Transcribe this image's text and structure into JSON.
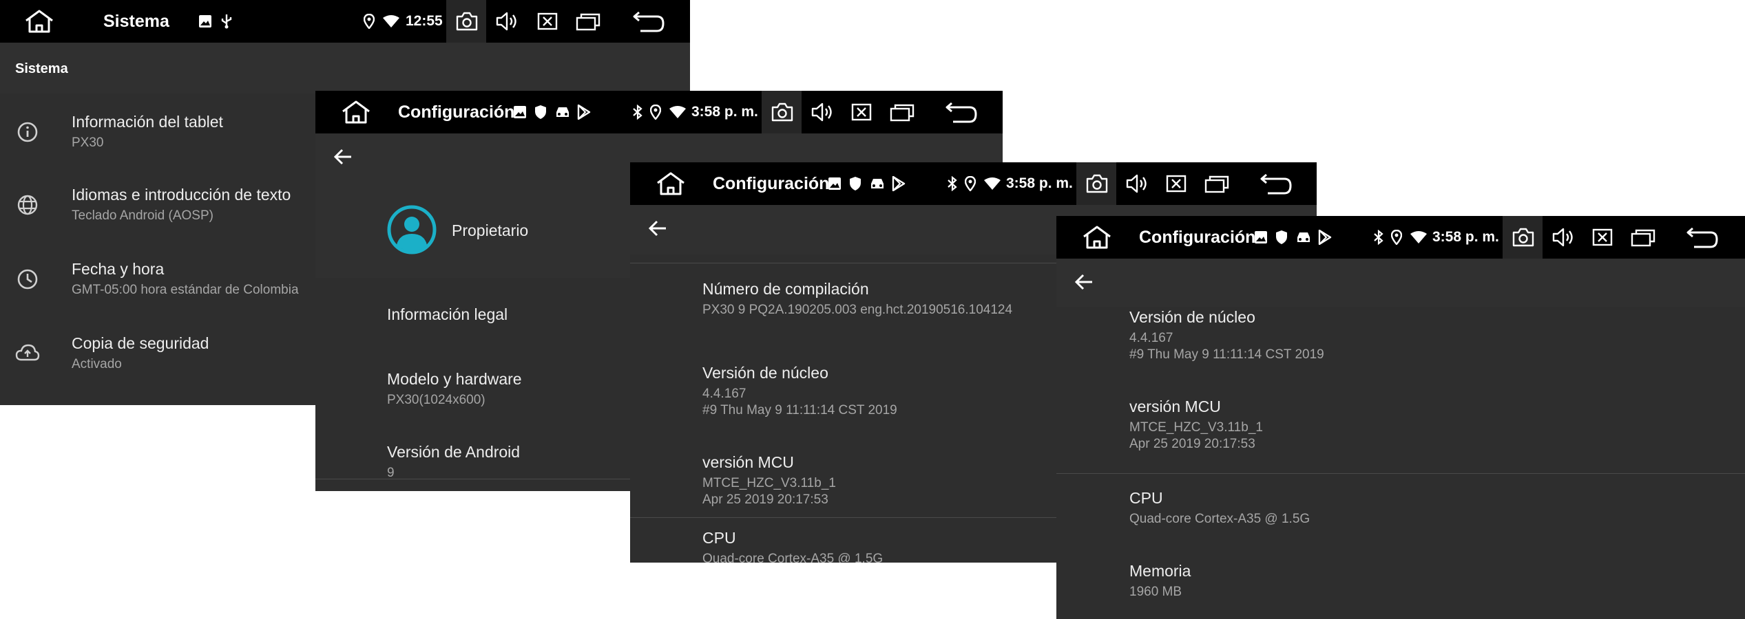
{
  "window1": {
    "status_title": "Sistema",
    "time": "12:55",
    "header": "Sistema",
    "items": [
      {
        "title": "Información del tablet",
        "subtitle": "PX30",
        "icon": "info-icon"
      },
      {
        "title": "Idiomas e introducción de texto",
        "subtitle": "Teclado Android (AOSP)",
        "icon": "globe-icon"
      },
      {
        "title": "Fecha y hora",
        "subtitle": "GMT-05:00 hora estándar de Colombia",
        "icon": "clock-icon"
      },
      {
        "title": "Copia de seguridad",
        "subtitle": "Activado",
        "icon": "cloud-backup-icon"
      }
    ]
  },
  "window2": {
    "status_title": "Configuración",
    "time": "3:58 p. m.",
    "owner": "Propietario",
    "items": [
      {
        "title": "Información legal",
        "subtitle": ""
      },
      {
        "title": "Modelo y hardware",
        "subtitle": "PX30(1024x600)"
      },
      {
        "title": "Versión de Android",
        "subtitle": "9"
      }
    ]
  },
  "window3": {
    "status_title": "Configuración",
    "time": "3:58 p. m.",
    "items": [
      {
        "title": "Número de compilación",
        "line1": "PX30 9 PQ2A.190205.003 eng.hct.20190516.104124",
        "line2": ""
      },
      {
        "title": "Versión de núcleo",
        "line1": "4.4.167",
        "line2": "#9 Thu May 9 11:11:14 CST 2019"
      },
      {
        "title": "versión MCU",
        "line1": "MTCE_HZC_V3.11b_1",
        "line2": "Apr 25 2019 20:17:53"
      },
      {
        "title": "CPU",
        "line1": "Quad-core Cortex-A35 @  1.5G",
        "line2": ""
      }
    ]
  },
  "window4": {
    "status_title": "Configuración",
    "time": "3:58 p. m.",
    "items": [
      {
        "title": "Versión de núcleo",
        "line1": "4.4.167",
        "line2": "#9 Thu May 9 11:11:14 CST 2019"
      },
      {
        "title": "versión MCU",
        "line1": "MTCE_HZC_V3.11b_1",
        "line2": "Apr 25 2019 20:17:53"
      },
      {
        "title": "CPU",
        "line1": "Quad-core Cortex-A35 @  1.5G",
        "line2": ""
      },
      {
        "title": "Memoria",
        "line1": "1960 MB",
        "line2": ""
      }
    ]
  },
  "colors": {
    "statusbar": "#000000",
    "background": "#2e2e2e",
    "header": "#303030",
    "avatar": "#1bb0c8",
    "subtitle": "#a6a6a6"
  }
}
